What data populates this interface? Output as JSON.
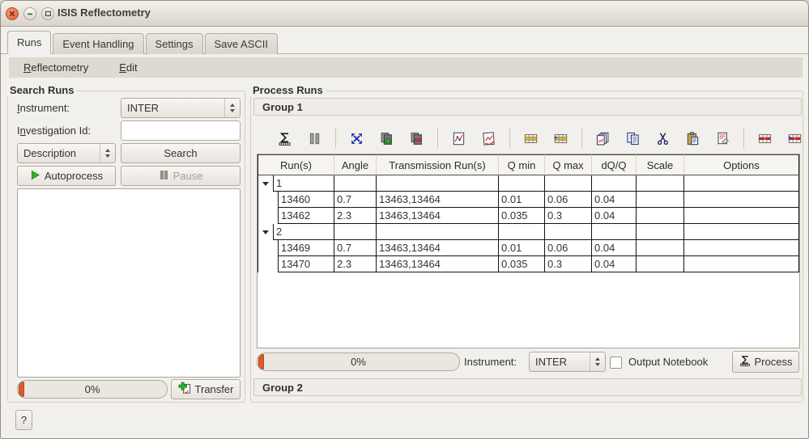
{
  "window": {
    "title": "ISIS Reflectometry",
    "buttons": [
      "close",
      "minimize",
      "maximize"
    ]
  },
  "tabs": {
    "items": [
      {
        "label": "Runs",
        "active": true
      },
      {
        "label": "Event Handling",
        "active": false
      },
      {
        "label": "Settings",
        "active": false
      },
      {
        "label": "Save ASCII",
        "active": false
      }
    ]
  },
  "menubar": {
    "reflectometry": {
      "u": "R",
      "rest": "eflectometry"
    },
    "edit": {
      "u": "E",
      "rest": "dit"
    }
  },
  "search": {
    "title": "Search Runs",
    "instrument": {
      "pre": "",
      "u": "I",
      "rest": "nstrument:",
      "value": "INTER"
    },
    "investigation": {
      "pre": "I",
      "u": "n",
      "rest": "vestigation Id:",
      "value": ""
    },
    "description_value": "Description",
    "search_button": "Search",
    "autoprocess_button": "Autoprocess",
    "pause_button": "Pause",
    "results_list": [],
    "progress_text": "0%",
    "transfer_button": "Transfer"
  },
  "process": {
    "title": "Process Runs",
    "group1_label": "Group 1",
    "group2_label": "Group 2",
    "toolbar_icons": [
      "process-icon",
      "pause-icon",
      "expand-all-groups-icon",
      "insert-group-icon",
      "delete-group-icon",
      "plot-runs-icon",
      "plot-group-icon",
      "insert-row-icon",
      "insert-row-after-icon",
      "group-rows-icon",
      "copy-icon",
      "cut-icon",
      "paste-icon",
      "clear-icon",
      "delete-row-icon",
      "delete-group-row-icon",
      "whats-this-icon"
    ],
    "table": {
      "columns": [
        "Run(s)",
        "Angle",
        "Transmission Run(s)",
        "Q min",
        "Q max",
        "dQ/Q",
        "Scale",
        "Options"
      ],
      "groups": [
        {
          "id": "1",
          "rows": [
            [
              "13460",
              "0.7",
              "13463,13464",
              "0.01",
              "0.06",
              "0.04",
              "",
              ""
            ],
            [
              "13462",
              "2.3",
              "13463,13464",
              "0.035",
              "0.3",
              "0.04",
              "",
              ""
            ]
          ]
        },
        {
          "id": "2",
          "rows": [
            [
              "13469",
              "0.7",
              "13463,13464",
              "0.01",
              "0.06",
              "0.04",
              "",
              ""
            ],
            [
              "13470",
              "2.3",
              "13463,13464",
              "0.035",
              "0.3",
              "0.04",
              "",
              ""
            ]
          ]
        }
      ]
    },
    "progress_text": "0%",
    "instrument_label": "Instrument:",
    "instrument_value": "INTER",
    "output_notebook_label": "Output Notebook",
    "output_notebook_checked": false,
    "process_button": "Process"
  },
  "help_button": "?",
  "colors": {
    "ubuntu_orange": "#e0592a",
    "green": "#2cb42c",
    "red": "#d82828",
    "blue": "#2438c8",
    "window_bg": "#f2f0ec"
  }
}
